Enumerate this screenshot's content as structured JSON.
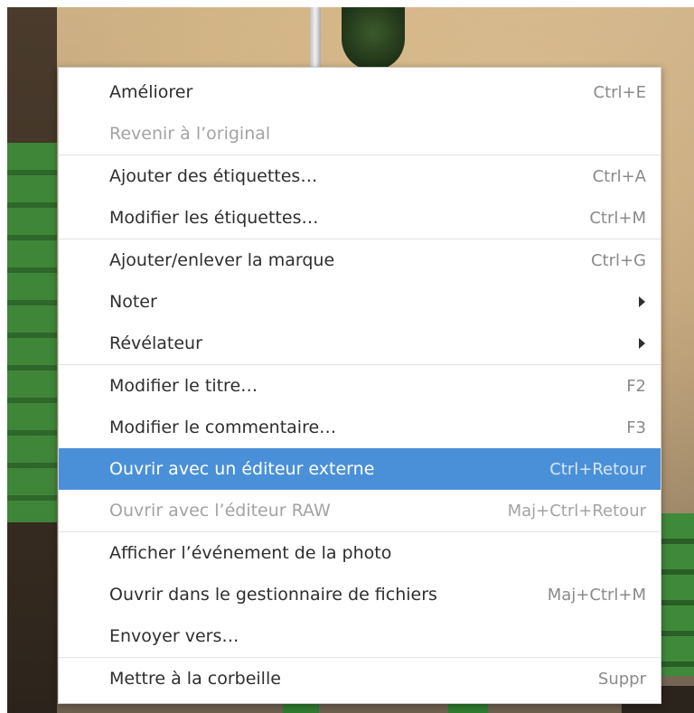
{
  "menu": {
    "groups": [
      [
        {
          "label": "Améliorer",
          "shortcut": "Ctrl+E",
          "disabled": false
        },
        {
          "label": "Revenir à l’original",
          "shortcut": "",
          "disabled": true
        }
      ],
      [
        {
          "label": "Ajouter des étiquettes…",
          "shortcut": "Ctrl+A",
          "disabled": false
        },
        {
          "label": "Modifier les étiquettes…",
          "shortcut": "Ctrl+M",
          "disabled": false
        }
      ],
      [
        {
          "label": "Ajouter/enlever la marque",
          "shortcut": "Ctrl+G",
          "disabled": false
        },
        {
          "label": "Noter",
          "shortcut": "",
          "submenu": true,
          "disabled": false
        },
        {
          "label": "Révélateur",
          "shortcut": "",
          "submenu": true,
          "disabled": false
        }
      ],
      [
        {
          "label": "Modifier le titre…",
          "shortcut": "F2",
          "disabled": false
        },
        {
          "label": "Modifier le commentaire…",
          "shortcut": "F3",
          "disabled": false
        },
        {
          "label": "Ouvrir avec un éditeur externe",
          "shortcut": "Ctrl+Retour",
          "disabled": false,
          "highlighted": true
        },
        {
          "label": "Ouvrir avec l’éditeur RAW",
          "shortcut": "Maj+Ctrl+Retour",
          "disabled": true
        }
      ],
      [
        {
          "label": "Afficher l’événement de la photo",
          "shortcut": "",
          "disabled": false
        },
        {
          "label": "Ouvrir dans le gestionnaire de fichiers",
          "shortcut": "Maj+Ctrl+M",
          "disabled": false
        },
        {
          "label": "Envoyer vers…",
          "shortcut": "",
          "disabled": false
        }
      ],
      [
        {
          "label": "Mettre à la corbeille",
          "shortcut": "Suppr",
          "disabled": false
        }
      ]
    ]
  },
  "colors": {
    "highlight": "#4a90d9",
    "text": "#2e2e2e",
    "disabled_text": "#a3a3a3",
    "shortcut_text": "#8a8a8a"
  },
  "icons": {
    "submenu": "triangle-right-icon"
  }
}
